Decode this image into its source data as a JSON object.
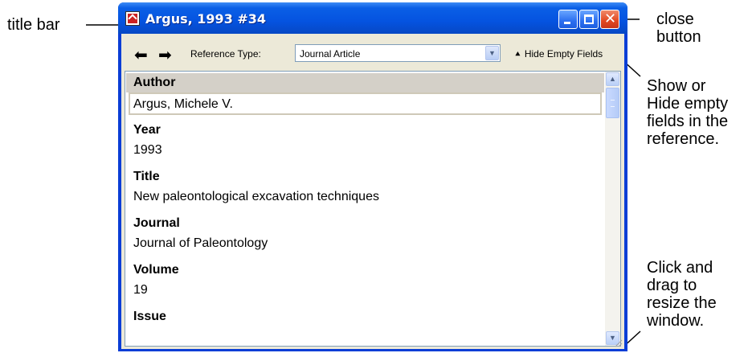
{
  "callouts": {
    "title_bar": "title bar",
    "close_button": "close\nbutton",
    "show_hide": "Show or\nHide empty\nfields in the\nreference.",
    "resize": "Click and\ndrag to\nresize the\nwindow."
  },
  "window": {
    "title": "Argus, 1993 #34",
    "close_glyph": "✕"
  },
  "toolbar": {
    "back_glyph": "⬅",
    "forward_glyph": "➡",
    "reference_type_label": "Reference Type:",
    "reference_type_value": "Journal Article",
    "hide_empty_icon": "⯅",
    "hide_empty_label": "Hide Empty Fields"
  },
  "fields": [
    {
      "label": "Author",
      "value": "Argus, Michele V."
    },
    {
      "label": "Year",
      "value": "1993"
    },
    {
      "label": "Title",
      "value": "New paleontological excavation techniques"
    },
    {
      "label": "Journal",
      "value": "Journal of Paleontology"
    },
    {
      "label": "Volume",
      "value": "19"
    },
    {
      "label": "Issue",
      "value": ""
    }
  ],
  "icons": {
    "app": "endnote-reference-icon",
    "minimize": "minimize-icon",
    "maximize": "maximize-icon",
    "close": "close-icon",
    "back": "back-arrow-icon",
    "forward": "forward-arrow-icon",
    "dropdown": "chevron-down-icon",
    "hide_empty": "caret-up-icon",
    "scroll_up": "chevron-up-icon",
    "scroll_down": "chevron-down-icon"
  },
  "colors": {
    "titlebar": "#0553e0",
    "window_frame": "#0a3ed6",
    "close_button": "#e2471f",
    "client_bg": "#ece9d8",
    "author_band": "#d4d0c8"
  }
}
